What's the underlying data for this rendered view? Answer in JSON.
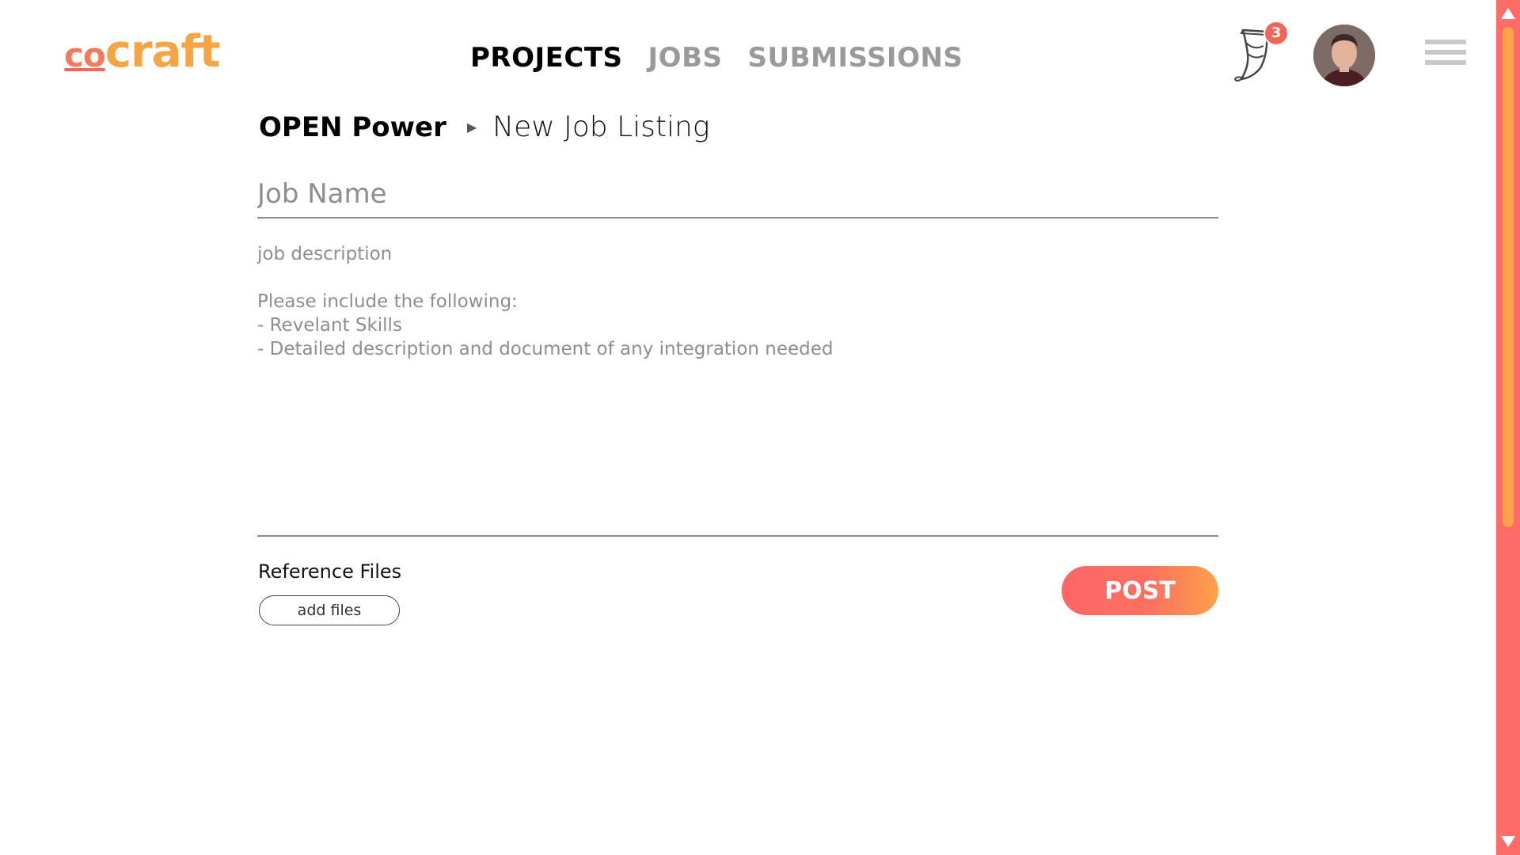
{
  "app": {
    "logo_prefix": "co",
    "logo_suffix": "craft"
  },
  "nav": {
    "items": [
      {
        "label": "PROJECTS",
        "active": true
      },
      {
        "label": "JOBS",
        "active": false
      },
      {
        "label": "SUBMISSIONS",
        "active": false
      }
    ]
  },
  "header": {
    "notification_icon": "horn-icon",
    "notification_count": "3",
    "avatar_icon": "user-avatar",
    "menu_icon": "hamburger-menu-icon"
  },
  "breadcrumb": {
    "project": "OPEN Power",
    "separator_icon": "triangle-right-icon",
    "page": "New Job Listing"
  },
  "form": {
    "job_name_placeholder": "Job Name",
    "job_name_value": "",
    "description_placeholder": "job description\n\nPlease include the following:\n- Revelant Skills\n- Detailed description and document of any integration needed",
    "description_value": "",
    "reference_files_label": "Reference Files",
    "add_files_label": "add files",
    "post_label": "POST"
  },
  "colors": {
    "accent_red": "#fd6767",
    "accent_orange": "#fda24a",
    "nav_inactive": "#9a9a9a"
  }
}
